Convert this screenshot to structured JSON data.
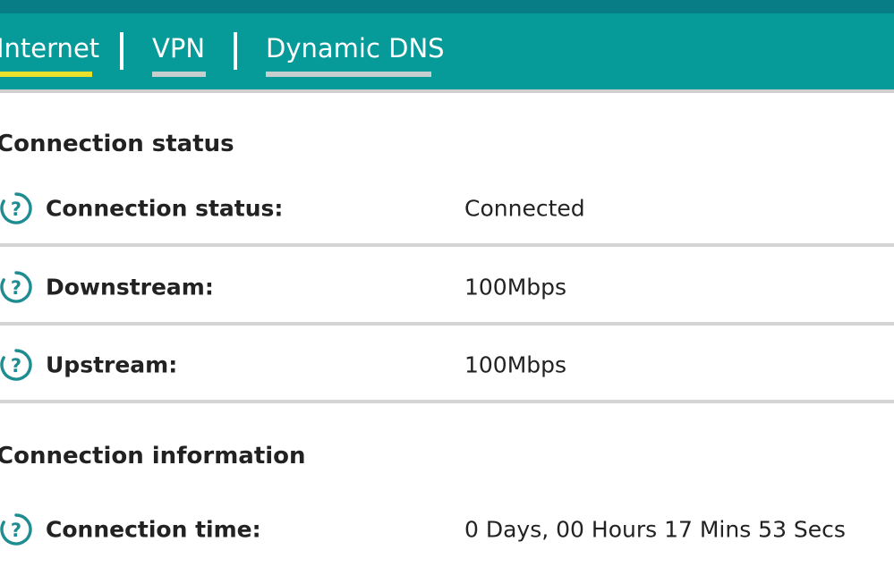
{
  "colors": {
    "header_dark": "#087d86",
    "header_teal": "#069a99",
    "active_underline": "#e8e02a",
    "inactive_underline": "#c6ced0",
    "help_icon": "#1f8c91"
  },
  "tabs": [
    {
      "label": "Internet",
      "active": true
    },
    {
      "label": "VPN",
      "active": false
    },
    {
      "label": "Dynamic DNS",
      "active": false
    }
  ],
  "sections": {
    "status": {
      "title": "Connection status",
      "rows": [
        {
          "icon": "help-circle-icon",
          "label": "Connection status:",
          "value": "Connected"
        },
        {
          "icon": "help-circle-icon",
          "label": "Downstream:",
          "value": "100Mbps"
        },
        {
          "icon": "help-circle-icon",
          "label": "Upstream:",
          "value": "100Mbps"
        }
      ]
    },
    "info": {
      "title": "Connection information",
      "rows": [
        {
          "icon": "help-circle-icon",
          "label": "Connection time:",
          "value": "0 Days, 00 Hours 17 Mins 53 Secs"
        }
      ]
    }
  }
}
